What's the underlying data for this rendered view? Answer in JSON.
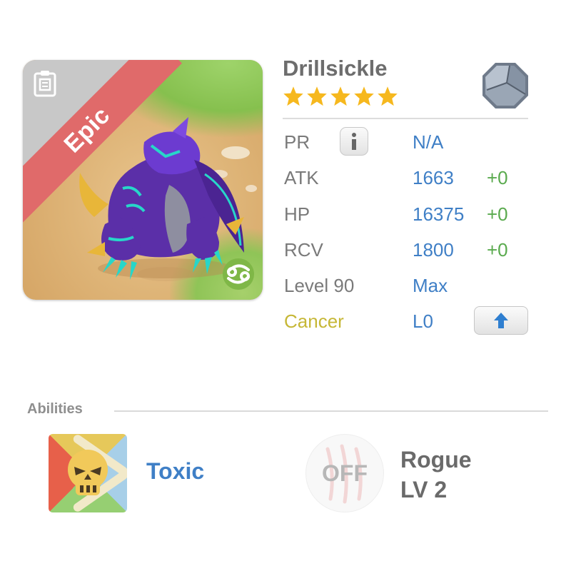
{
  "monster": {
    "name": "Drillsickle",
    "rarity": "Epic",
    "stars": 5,
    "element_icon": "stone-octagon-icon",
    "zodiac_icon": "cancer-icon",
    "card_icon": "clipboard-icon"
  },
  "stats": {
    "pr": {
      "label": "PR",
      "value": "N/A"
    },
    "atk": {
      "label": "ATK",
      "value": "1663",
      "bonus": "+0"
    },
    "hp": {
      "label": "HP",
      "value": "16375",
      "bonus": "+0"
    },
    "rcv": {
      "label": "RCV",
      "value": "1800",
      "bonus": "+0"
    },
    "level": {
      "label": "Level 90",
      "value": "Max"
    },
    "sign": {
      "label": "Cancer",
      "value": "L0"
    }
  },
  "abilities": {
    "label": "Abilities",
    "items": [
      {
        "name": "Toxic",
        "icon": "skull-crossbones-icon"
      },
      {
        "state": "OFF",
        "name": "Rogue",
        "level": "LV 2",
        "icon": "claw-marks-icon"
      }
    ]
  },
  "colors": {
    "rarity_ribbon": "#e06a6a",
    "stat_value": "#3f7fc6",
    "stat_bonus": "#5aaa4e",
    "zodiac_label": "#c6b736",
    "star": "#f6b81e"
  }
}
